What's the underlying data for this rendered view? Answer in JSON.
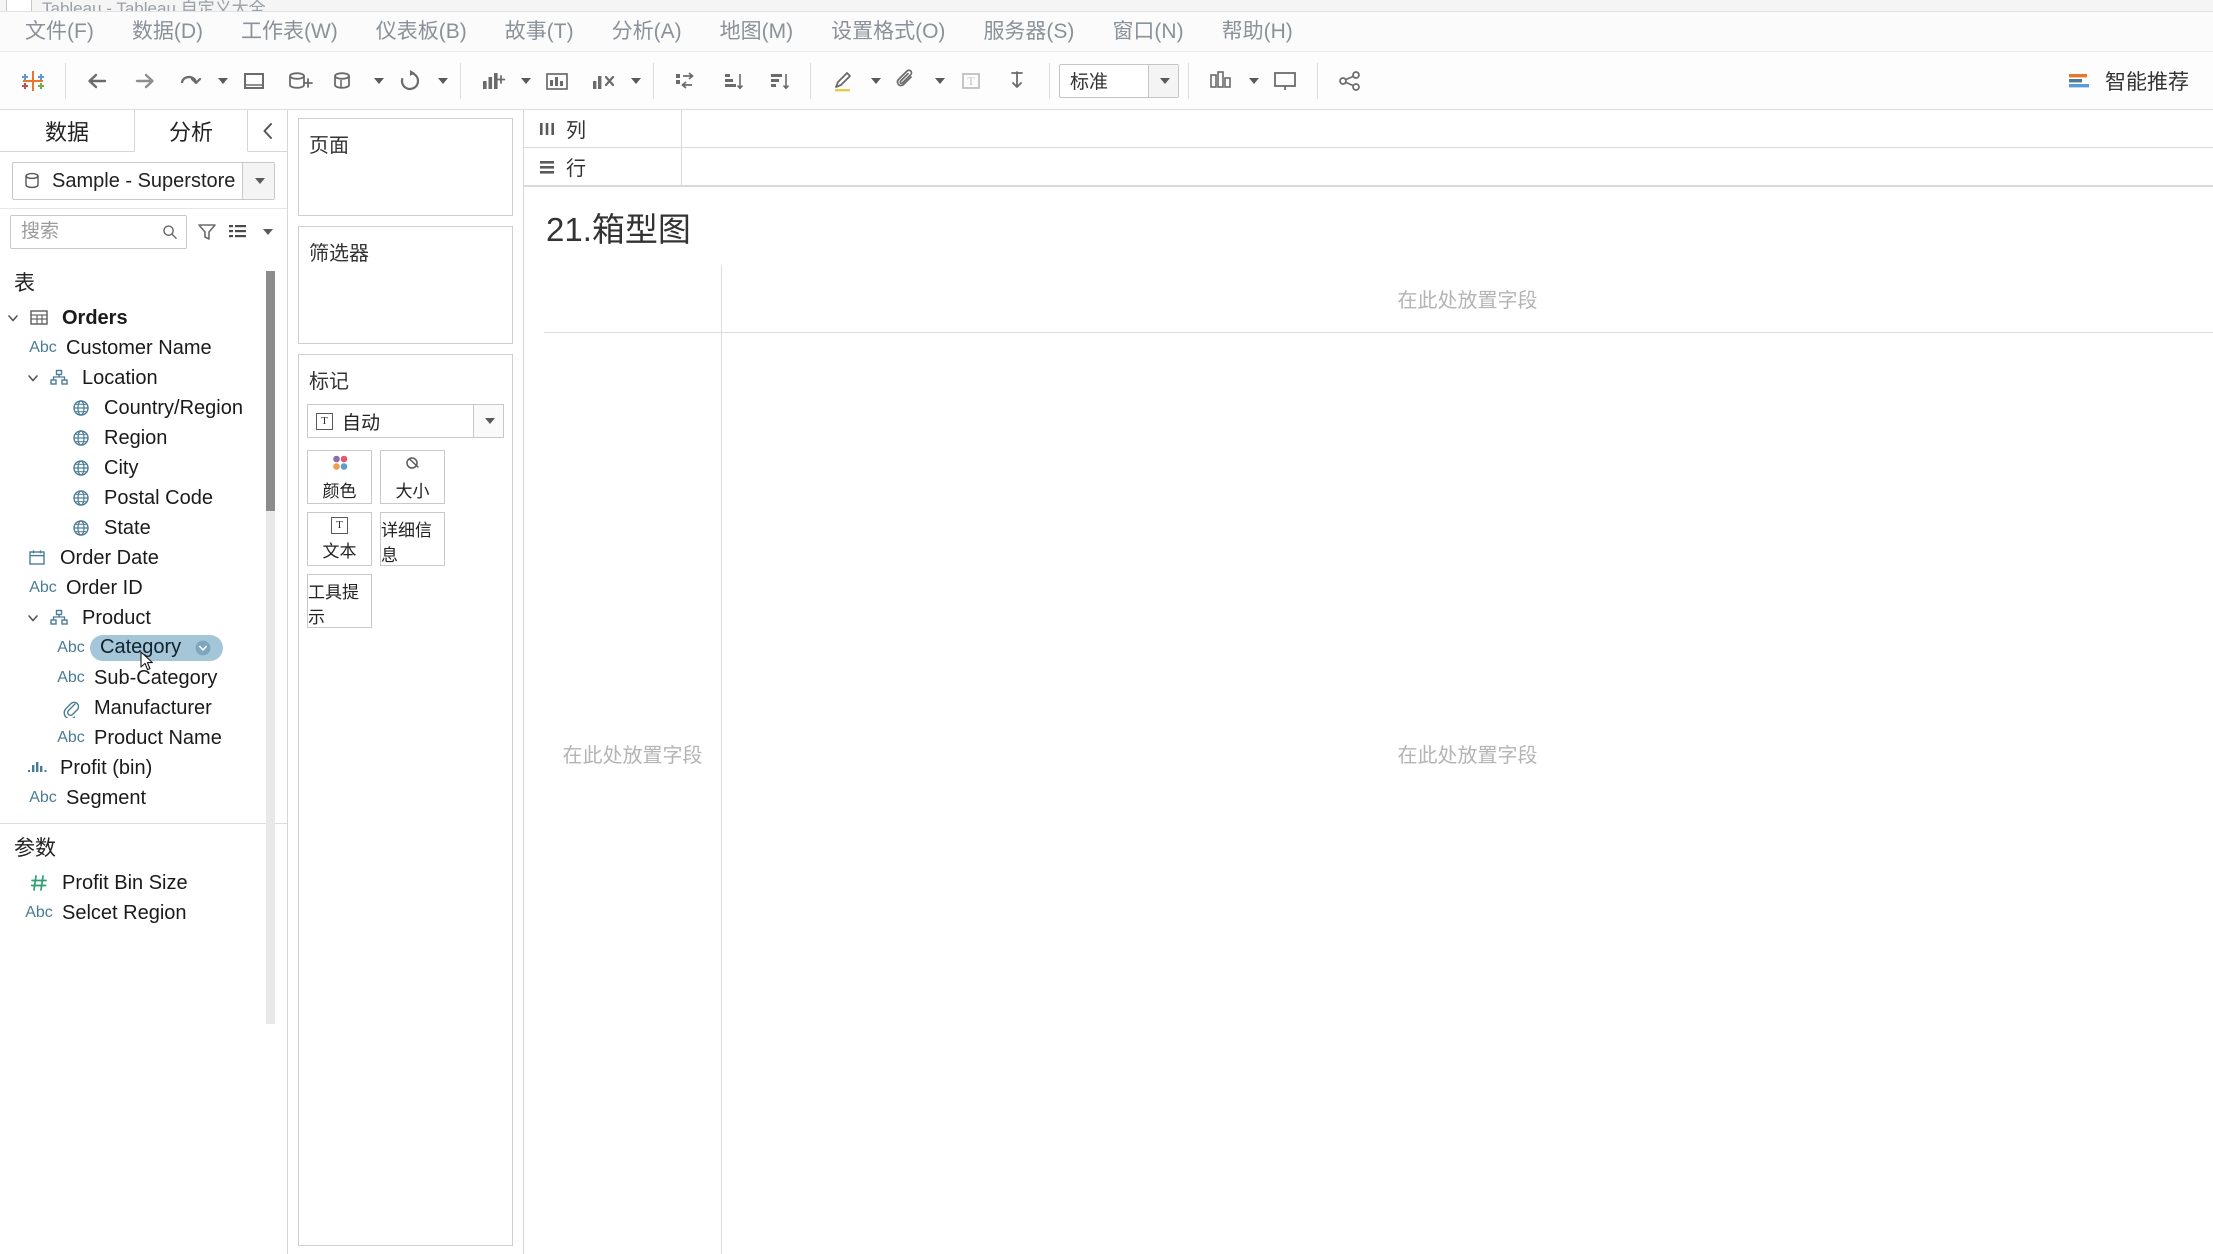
{
  "titlebar": {
    "text": "Tableau - Tableau 自定义大全"
  },
  "menu": {
    "items": [
      {
        "label": "文件(F)",
        "name": "menu-file"
      },
      {
        "label": "数据(D)",
        "name": "menu-data"
      },
      {
        "label": "工作表(W)",
        "name": "menu-worksheet"
      },
      {
        "label": "仪表板(B)",
        "name": "menu-dashboard"
      },
      {
        "label": "故事(T)",
        "name": "menu-story"
      },
      {
        "label": "分析(A)",
        "name": "menu-analysis"
      },
      {
        "label": "地图(M)",
        "name": "menu-map"
      },
      {
        "label": "设置格式(O)",
        "name": "menu-format"
      },
      {
        "label": "服务器(S)",
        "name": "menu-server"
      },
      {
        "label": "窗口(N)",
        "name": "menu-window"
      },
      {
        "label": "帮助(H)",
        "name": "menu-help"
      }
    ]
  },
  "toolbar": {
    "fit_value": "标准",
    "smart_recommend_label": "智能推荐",
    "icons": [
      "tableau-logo-icon",
      "undo-icon",
      "redo-icon",
      "save-icon",
      "new-data-source-icon",
      "new-worksheet-icon",
      "duplicate-sheet-icon",
      "clear-sheet-icon",
      "refresh-data-source-icon",
      "pause-auto-update-icon",
      "swap-rows-columns-icon",
      "sort-ascending-icon",
      "sort-descending-icon",
      "highlight-icon",
      "group-members-icon",
      "show-mark-labels-icon",
      "fix-axes-icon",
      "presentation-mode-icon",
      "share-icon",
      "show-me-icon"
    ]
  },
  "datapane": {
    "tabs": [
      {
        "label": "数据",
        "name": "tab-data",
        "selected": false
      },
      {
        "label": "分析",
        "name": "tab-analytics",
        "selected": true
      }
    ],
    "datasource": "Sample - Superstore",
    "search_placeholder": "搜索",
    "search_value": "",
    "tables_section_title": "表",
    "parameters_section_title": "参数",
    "fields": [
      {
        "label": "Orders",
        "icon": "table-icon",
        "indent": 0,
        "chevron": "down",
        "bold": true
      },
      {
        "label": "Customer Name",
        "icon": "abc-icon",
        "indent": 1,
        "chevron": "",
        "bold": false
      },
      {
        "label": "Location",
        "icon": "hierarchy-icon",
        "indent": 1,
        "chevron": "down",
        "bold": false
      },
      {
        "label": "Country/Region",
        "icon": "globe-icon",
        "indent": 2,
        "chevron": "",
        "bold": false
      },
      {
        "label": "Region",
        "icon": "globe-icon",
        "indent": 2,
        "chevron": "",
        "bold": false
      },
      {
        "label": "City",
        "icon": "globe-icon",
        "indent": 2,
        "chevron": "",
        "bold": false
      },
      {
        "label": "Postal Code",
        "icon": "globe-icon",
        "indent": 2,
        "chevron": "",
        "bold": false
      },
      {
        "label": "State",
        "icon": "globe-icon",
        "indent": 2,
        "chevron": "",
        "bold": false
      },
      {
        "label": "Order Date",
        "icon": "calendar-icon",
        "indent": 1,
        "chevron": "",
        "bold": false
      },
      {
        "label": "Order ID",
        "icon": "abc-icon",
        "indent": 1,
        "chevron": "",
        "bold": false
      },
      {
        "label": "Product",
        "icon": "hierarchy-icon",
        "indent": 1,
        "chevron": "down",
        "bold": false
      },
      {
        "label": "Category",
        "icon": "abc-icon",
        "indent": 2,
        "chevron": "",
        "bold": false,
        "selected": true
      },
      {
        "label": "Sub-Category",
        "icon": "abc-icon",
        "indent": 2,
        "chevron": "",
        "bold": false
      },
      {
        "label": "Manufacturer",
        "icon": "paperclip-icon",
        "indent": 2,
        "chevron": "",
        "bold": false
      },
      {
        "label": "Product Name",
        "icon": "abc-icon",
        "indent": 2,
        "chevron": "",
        "bold": false
      },
      {
        "label": "Profit (bin)",
        "icon": "bin-icon",
        "indent": 1,
        "chevron": "",
        "bold": false
      },
      {
        "label": "Segment",
        "icon": "abc-icon",
        "indent": 1,
        "chevron": "",
        "bold": false
      }
    ],
    "parameters": [
      {
        "label": "Profit Bin Size",
        "icon": "number-icon"
      },
      {
        "label": "Selcet Region",
        "icon": "abc-icon"
      }
    ]
  },
  "shelves": {
    "pages_label": "页面",
    "filters_label": "筛选器",
    "marks_label": "标记",
    "mark_type": "自动",
    "mark_buttons": [
      {
        "label": "颜色",
        "name": "marks-color-button",
        "icon": "color-dots-icon"
      },
      {
        "label": "大小",
        "name": "marks-size-button",
        "icon": "size-icon"
      },
      {
        "label": "文本",
        "name": "marks-text-button",
        "icon": "text-icon"
      },
      {
        "label": "详细信息",
        "name": "marks-detail-button",
        "icon": "detail-dots-icon"
      },
      {
        "label": "工具提示",
        "name": "marks-tooltip-button",
        "icon": "tooltip-icon"
      }
    ]
  },
  "worksheet": {
    "columns_label": "列",
    "rows_label": "行",
    "title": "21.箱型图",
    "drop_field_hint": "在此处放置字段"
  },
  "colors": {
    "selection_pill": "#a5c6d8",
    "field_icon_blue": "#4a7c96",
    "parameter_green": "#2e9e74",
    "hint_gray": "#b4b4b4",
    "accent_orange": "#e8762c"
  }
}
